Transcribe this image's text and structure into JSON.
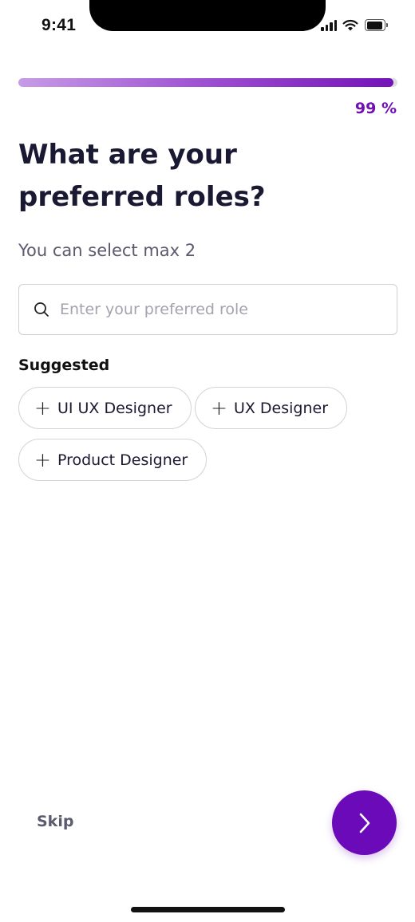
{
  "status_bar": {
    "time": "9:41",
    "signal_icon": "cellular-signal-icon",
    "wifi_icon": "wifi-icon",
    "battery_icon": "battery-icon"
  },
  "progress": {
    "value_percent": 99,
    "label": "99 %",
    "colors": {
      "start": "#c69be6",
      "end": "#7412b8"
    }
  },
  "header": {
    "title": "What are your preferred roles?",
    "subtitle": "You can select max 2"
  },
  "search": {
    "icon": "search-icon",
    "placeholder": "Enter your preferred role",
    "value": ""
  },
  "suggested": {
    "label": "Suggested",
    "chips": [
      {
        "icon": "plus-icon",
        "label": "UI UX Designer"
      },
      {
        "icon": "plus-icon",
        "label": "UX Designer"
      },
      {
        "icon": "plus-icon",
        "label": "Product Designer"
      }
    ]
  },
  "footer": {
    "skip_label": "Skip",
    "next_icon": "chevron-right-icon",
    "accent_color": "#6b0ab8"
  }
}
